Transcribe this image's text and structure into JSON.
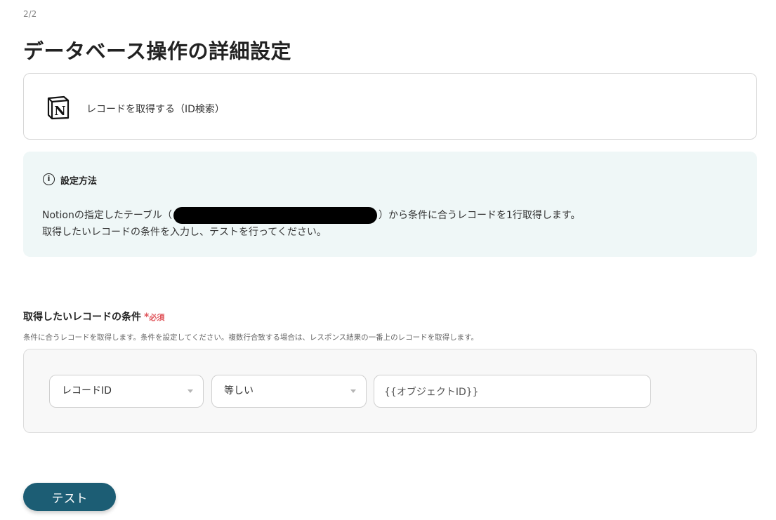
{
  "header": {
    "step": "2/2",
    "title": "データベース操作の詳細設定"
  },
  "action": {
    "app_icon": "notion-logo-icon",
    "label": "レコードを取得する（ID検索）"
  },
  "info": {
    "icon": "info-circle-icon",
    "heading": "設定方法",
    "line1_prefix": "Notionの指定したテーブル（",
    "line1_suffix": "）から条件に合うレコードを1行取得します。",
    "line2": "取得したいレコードの条件を入力し、テストを行ってください。"
  },
  "condition": {
    "label": "取得したいレコードの条件",
    "required_mark": "*",
    "required_text": "必須",
    "help": "条件に合うレコードを取得します。条件を設定してください。複数行合致する場合は、レスポンス結果の一番上のレコードを取得します。",
    "field": "レコードID",
    "operator": "等しい",
    "value": "{{オブジェクトID}}"
  },
  "buttons": {
    "test": "テスト"
  },
  "colors": {
    "primary": "#1c5d74",
    "info_bg": "#eff7f7",
    "required": "#e0555b"
  }
}
